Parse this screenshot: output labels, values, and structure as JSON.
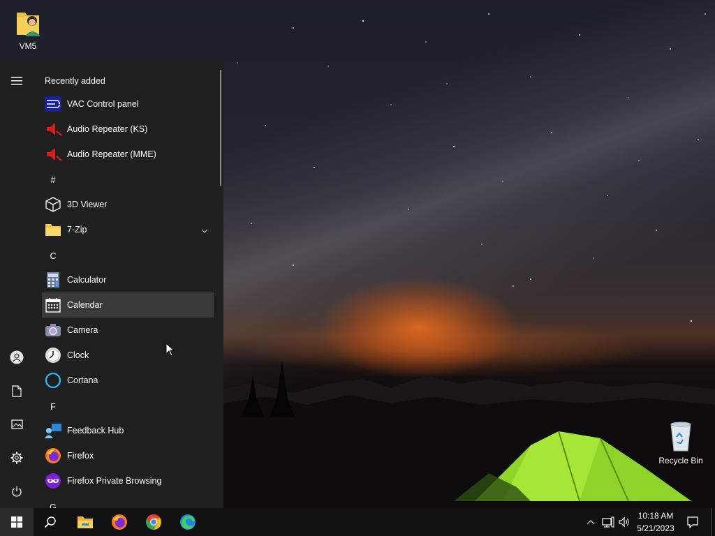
{
  "desktop": {
    "icons": {
      "vm5": "VM5",
      "recycle_bin": "Recycle Bin"
    }
  },
  "start_menu": {
    "recently_added_header": "Recently added",
    "recent_apps": [
      "VAC Control panel",
      "Audio Repeater (KS)",
      "Audio Repeater (MME)"
    ],
    "sections": {
      "hash": "#",
      "c": "C",
      "f": "F",
      "g": "G"
    },
    "apps": {
      "viewer_3d": "3D Viewer",
      "zip_7": "7-Zip",
      "calculator": "Calculator",
      "calendar": "Calendar",
      "camera": "Camera",
      "clock": "Clock",
      "cortana": "Cortana",
      "feedback_hub": "Feedback Hub",
      "firefox": "Firefox",
      "firefox_private": "Firefox Private Browsing"
    },
    "hovered_item": "Calendar"
  },
  "taskbar": {
    "pinned": [
      "search-icon",
      "file-explorer-icon",
      "firefox-icon",
      "chrome-icon",
      "edge-icon"
    ],
    "clock": {
      "time": "10:18 AM",
      "date": "5/21/2023"
    }
  },
  "colors": {
    "menu_bg": "#1f1f1f",
    "hover_bg": "#3a3a3a",
    "taskbar_bg": "#101010",
    "accent": "#0078d7"
  }
}
